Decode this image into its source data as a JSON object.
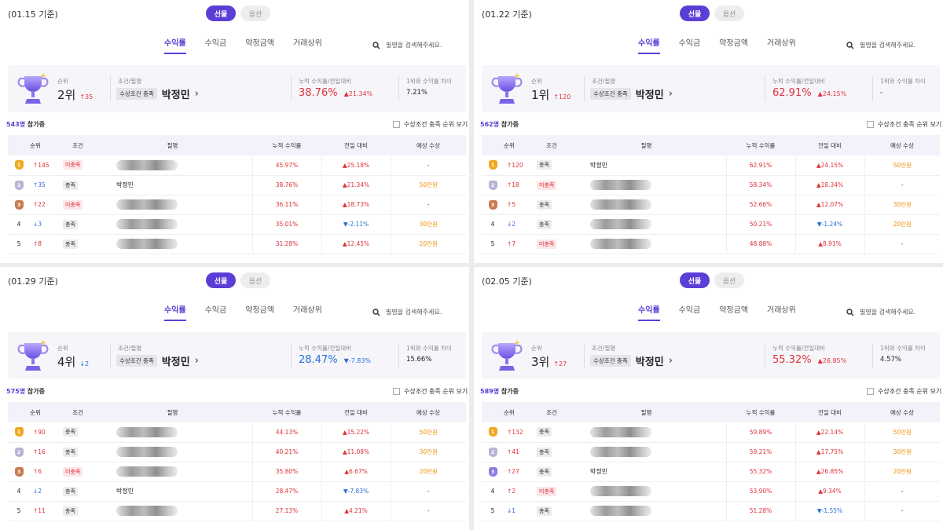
{
  "toggle": {
    "left": "선물",
    "right": "옵션"
  },
  "tabs": [
    "수익률",
    "수익금",
    "약정금액",
    "거래상위"
  ],
  "search_placeholder": "필명을 검색해주세요.",
  "labels": {
    "rank": "순위",
    "cond_name": "조건/필명",
    "ret": "누적 수익률/전일대비",
    "gap": "1위와 수익률 차이",
    "participants_suffix": "참가중",
    "checkbox": "수상조건 충족 순위 보기",
    "cond_badge": "수상조건 충족"
  },
  "table_headers": [
    "순위",
    "조건",
    "필명",
    "누적 수익률",
    "전일 대비",
    "예상 수상"
  ],
  "colors": {
    "accent": "#5b3ed6",
    "up": "#e0323a",
    "down": "#2a6fd8",
    "prize": "#f0920e"
  },
  "panels": [
    {
      "date": "(01.15 기준)",
      "summary": {
        "rank": "2위",
        "rank_change": "↑35",
        "dir": "up",
        "name": "박정민",
        "ret": "38.76%",
        "ret_dir": "up",
        "day": "▲21.34%",
        "day_dir": "up",
        "gap": "7.21%"
      },
      "participants": "543명",
      "rows": [
        {
          "rank": "1",
          "medal": "m1",
          "chg": "↑145",
          "chg_dir": "up",
          "cond": "미충족",
          "cond_ok": false,
          "name": "",
          "blur": true,
          "ret": "45.97%",
          "day": "▲25.18%",
          "day_dir": "up",
          "prize": "-"
        },
        {
          "rank": "2",
          "medal": "m2",
          "chg": "↑35",
          "chg_dir": "down",
          "cond": "충족",
          "cond_ok": true,
          "name": "박정민",
          "blur": false,
          "ret": "38.76%",
          "day": "▲21.34%",
          "day_dir": "up",
          "prize": "50만원"
        },
        {
          "rank": "3",
          "medal": "m3",
          "chg": "↑22",
          "chg_dir": "up",
          "cond": "미충족",
          "cond_ok": false,
          "name": "",
          "blur": true,
          "ret": "36.11%",
          "day": "▲18.73%",
          "day_dir": "up",
          "prize": "-"
        },
        {
          "rank": "4",
          "medal": "",
          "chg": "↓3",
          "chg_dir": "down",
          "cond": "충족",
          "cond_ok": true,
          "name": "",
          "blur": true,
          "ret": "35.01%",
          "day": "▼-2.11%",
          "day_dir": "down",
          "prize": "30만원"
        },
        {
          "rank": "5",
          "medal": "",
          "chg": "↑8",
          "chg_dir": "up",
          "cond": "충족",
          "cond_ok": true,
          "name": "",
          "blur": true,
          "ret": "31.28%",
          "day": "▲12.45%",
          "day_dir": "up",
          "prize": "20만원"
        }
      ]
    },
    {
      "date": "(01.22 기준)",
      "summary": {
        "rank": "1위",
        "rank_change": "↑120",
        "dir": "up",
        "name": "박정민",
        "ret": "62.91%",
        "ret_dir": "up",
        "day": "▲24.15%",
        "day_dir": "up",
        "gap": "-"
      },
      "participants": "562명",
      "rows": [
        {
          "rank": "1",
          "medal": "m1",
          "chg": "↑120",
          "chg_dir": "up",
          "cond": "충족",
          "cond_ok": true,
          "name": "박정민",
          "blur": false,
          "ret": "62.91%",
          "day": "▲24.15%",
          "day_dir": "up",
          "prize": "50만원"
        },
        {
          "rank": "2",
          "medal": "m2",
          "chg": "↑18",
          "chg_dir": "up",
          "cond": "미충족",
          "cond_ok": false,
          "name": "",
          "blur": true,
          "ret": "58.34%",
          "day": "▲18.34%",
          "day_dir": "up",
          "prize": "-"
        },
        {
          "rank": "3",
          "medal": "m3",
          "chg": "↑5",
          "chg_dir": "up",
          "cond": "충족",
          "cond_ok": true,
          "name": "",
          "blur": true,
          "ret": "52.66%",
          "day": "▲12.07%",
          "day_dir": "up",
          "prize": "30만원"
        },
        {
          "rank": "4",
          "medal": "",
          "chg": "↓2",
          "chg_dir": "down",
          "cond": "충족",
          "cond_ok": true,
          "name": "",
          "blur": true,
          "ret": "50.21%",
          "day": "▼-1.24%",
          "day_dir": "down",
          "prize": "20만원"
        },
        {
          "rank": "5",
          "medal": "",
          "chg": "↑7",
          "chg_dir": "up",
          "cond": "미충족",
          "cond_ok": false,
          "name": "",
          "blur": true,
          "ret": "48.88%",
          "day": "▲8.91%",
          "day_dir": "up",
          "prize": "-"
        }
      ]
    },
    {
      "date": "(01.29 기준)",
      "summary": {
        "rank": "4위",
        "rank_change": "↓2",
        "dir": "down",
        "name": "박정민",
        "ret": "28.47%",
        "ret_dir": "down",
        "day": "▼-7.83%",
        "day_dir": "down",
        "gap": "15.66%"
      },
      "participants": "575명",
      "rows": [
        {
          "rank": "1",
          "medal": "m1",
          "chg": "↑90",
          "chg_dir": "up",
          "cond": "충족",
          "cond_ok": true,
          "name": "",
          "blur": true,
          "ret": "44.13%",
          "day": "▲15.22%",
          "day_dir": "up",
          "prize": "50만원"
        },
        {
          "rank": "2",
          "medal": "m2",
          "chg": "↑16",
          "chg_dir": "up",
          "cond": "충족",
          "cond_ok": true,
          "name": "",
          "blur": true,
          "ret": "40.21%",
          "day": "▲11.08%",
          "day_dir": "up",
          "prize": "30만원"
        },
        {
          "rank": "3",
          "medal": "m3",
          "chg": "↑6",
          "chg_dir": "up",
          "cond": "미충족",
          "cond_ok": false,
          "name": "",
          "blur": true,
          "ret": "35.80%",
          "day": "▲6.67%",
          "day_dir": "up",
          "prize": "20만원"
        },
        {
          "rank": "4",
          "medal": "",
          "chg": "↓2",
          "chg_dir": "down",
          "cond": "충족",
          "cond_ok": true,
          "name": "박정민",
          "blur": false,
          "ret": "28.47%",
          "day": "▼-7.83%",
          "day_dir": "down",
          "prize": "-"
        },
        {
          "rank": "5",
          "medal": "",
          "chg": "↑11",
          "chg_dir": "up",
          "cond": "충족",
          "cond_ok": true,
          "name": "",
          "blur": true,
          "ret": "27.13%",
          "day": "▲4.21%",
          "day_dir": "up",
          "prize": "-"
        }
      ]
    },
    {
      "date": "(02.05 기준)",
      "summary": {
        "rank": "3위",
        "rank_change": "↑27",
        "dir": "up",
        "name": "박정민",
        "ret": "55.32%",
        "ret_dir": "up",
        "day": "▲26.85%",
        "day_dir": "up",
        "gap": "4.57%"
      },
      "participants": "589명",
      "rows": [
        {
          "rank": "1",
          "medal": "m1",
          "chg": "↑132",
          "chg_dir": "up",
          "cond": "충족",
          "cond_ok": true,
          "name": "",
          "blur": true,
          "ret": "59.89%",
          "day": "▲22.14%",
          "day_dir": "up",
          "prize": "50만원"
        },
        {
          "rank": "2",
          "medal": "m2",
          "chg": "↑41",
          "chg_dir": "up",
          "cond": "충족",
          "cond_ok": true,
          "name": "",
          "blur": true,
          "ret": "59.21%",
          "day": "▲17.75%",
          "day_dir": "up",
          "prize": "30만원"
        },
        {
          "rank": "3",
          "medal": "mp",
          "chg": "↑27",
          "chg_dir": "up",
          "cond": "충족",
          "cond_ok": true,
          "name": "박정민",
          "blur": false,
          "ret": "55.32%",
          "day": "▲26.85%",
          "day_dir": "up",
          "prize": "20만원"
        },
        {
          "rank": "4",
          "medal": "",
          "chg": "↑2",
          "chg_dir": "up",
          "cond": "미충족",
          "cond_ok": false,
          "name": "",
          "blur": true,
          "ret": "53.90%",
          "day": "▲9.34%",
          "day_dir": "up",
          "prize": "-"
        },
        {
          "rank": "5",
          "medal": "",
          "chg": "↓1",
          "chg_dir": "down",
          "cond": "충족",
          "cond_ok": true,
          "name": "",
          "blur": true,
          "ret": "51.28%",
          "day": "▼-1.55%",
          "day_dir": "down",
          "prize": "-"
        }
      ]
    }
  ]
}
